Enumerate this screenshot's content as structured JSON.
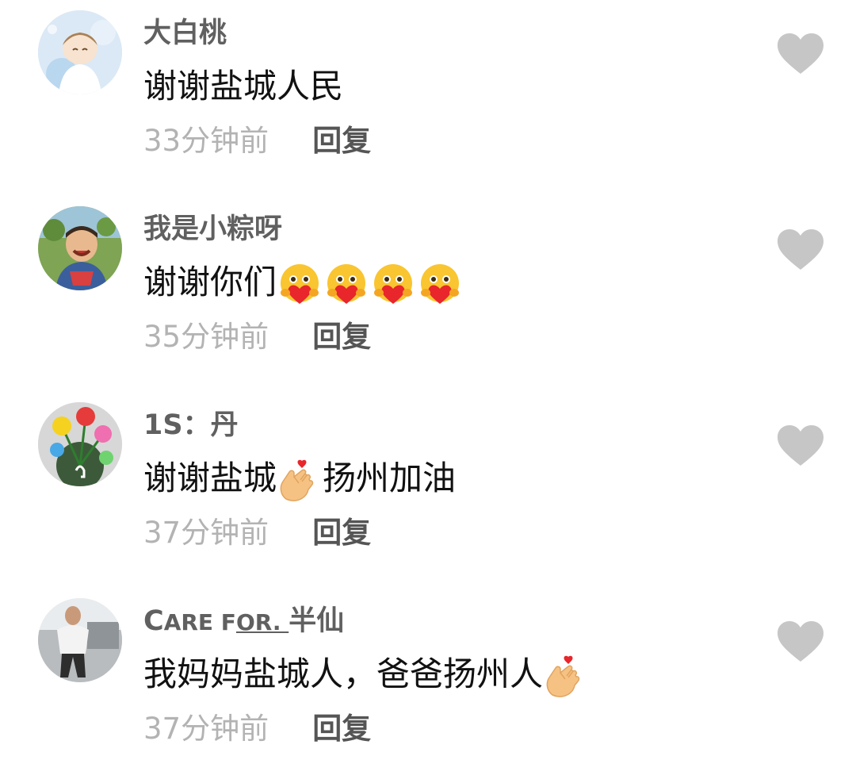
{
  "comments": [
    {
      "username": "大白桃",
      "text": "谢谢盐城人民",
      "time": "33分钟前",
      "reply": "回复"
    },
    {
      "username": "我是小粽呀",
      "text": "谢谢你们",
      "time": "35分钟前",
      "reply": "回复"
    },
    {
      "username": "1S：丹",
      "text_before": "谢谢盐城",
      "text_after": "扬州加油",
      "time": "37分钟前",
      "reply": "回复"
    },
    {
      "username_parts": [
        "C",
        "ARE ",
        "F",
        "OR. ",
        "半仙"
      ],
      "text": "我妈妈盐城人，爸爸扬州人",
      "time": "37分钟前",
      "reply": "回复"
    }
  ],
  "colors": {
    "username": "#606060",
    "text": "#111111",
    "time": "#b3b3b3",
    "reply": "#555555",
    "like_icon": "#c6c6c6"
  }
}
